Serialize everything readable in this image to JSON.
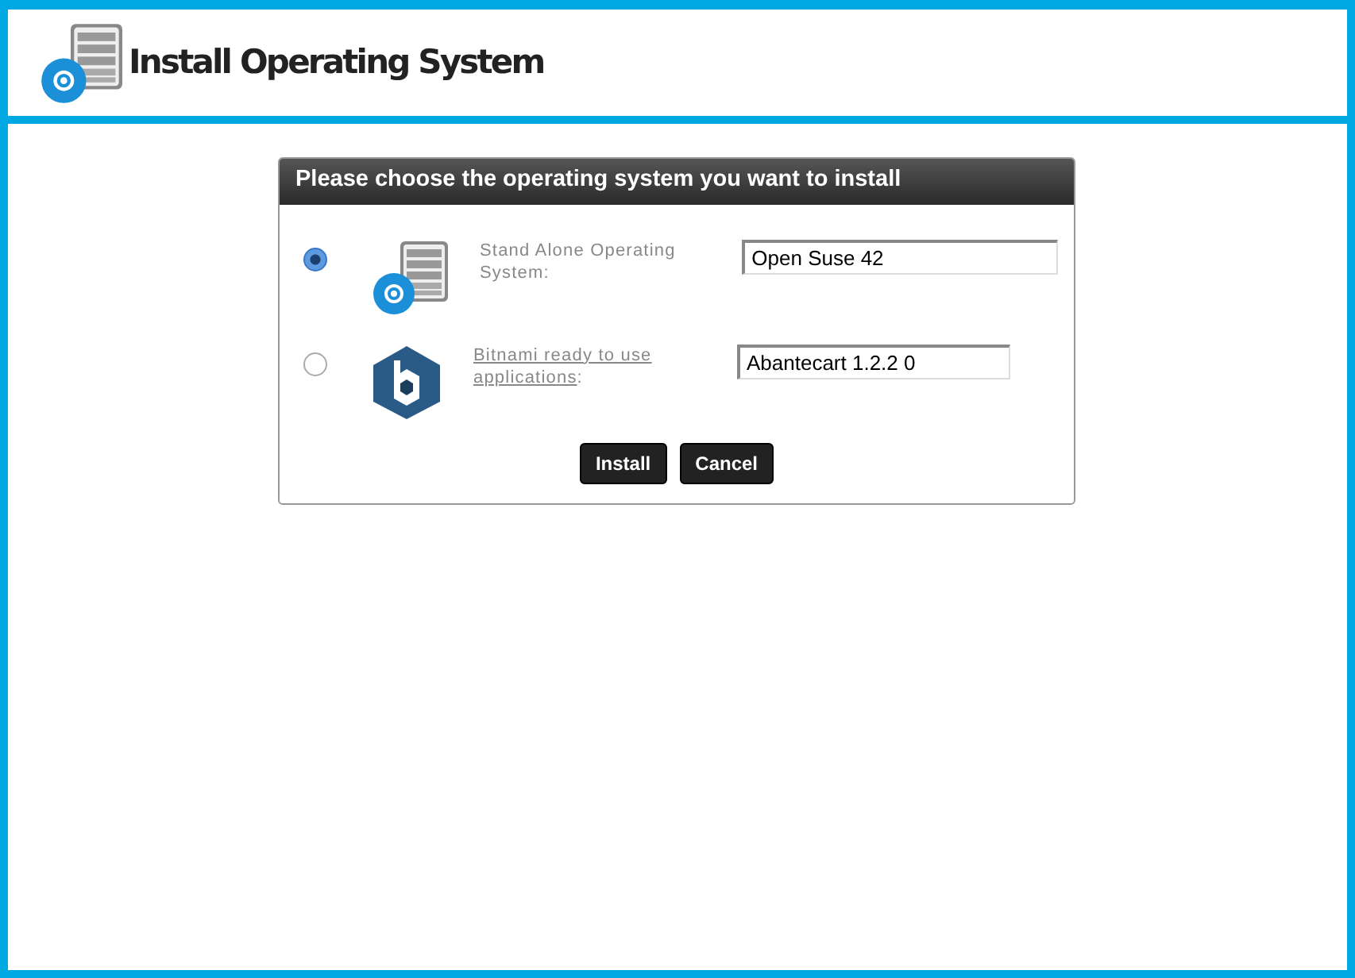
{
  "header": {
    "title": "Install Operating System"
  },
  "dialog": {
    "title": "Please choose the operating system you want to install",
    "options": [
      {
        "kind": "server",
        "selected": true,
        "label": "Stand Alone Operating System",
        "label_end": ":",
        "linked": false,
        "value": "Open Suse 42"
      },
      {
        "kind": "bitnami",
        "selected": false,
        "label": "Bitnami ready to use applications",
        "label_end": ":",
        "linked": true,
        "value": "Abantecart 1.2.2 0"
      }
    ],
    "buttons": [
      "Install",
      "Cancel"
    ]
  }
}
